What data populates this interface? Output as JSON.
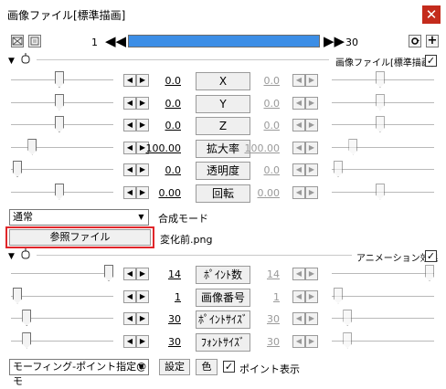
{
  "window": {
    "title": "画像ファイル[標準描画]",
    "close_glyph": "✕"
  },
  "frame": {
    "start": "1",
    "end": "30",
    "progress": 1.0
  },
  "section1": {
    "label": "画像ファイル[標準描画]",
    "checked": true
  },
  "params1": [
    {
      "label": "X",
      "value": "0.0",
      "value2": "0.0",
      "level": 0.47,
      "level2": 0.47
    },
    {
      "label": "Y",
      "value": "0.0",
      "value2": "0.0",
      "level": 0.47,
      "level2": 0.47
    },
    {
      "label": "Z",
      "value": "0.0",
      "value2": "0.0",
      "level": 0.47,
      "level2": 0.47
    },
    {
      "label": "拡大率",
      "value": "100.00",
      "value2": "100.00",
      "level": 0.18,
      "level2": 0.18
    },
    {
      "label": "透明度",
      "value": "0.0",
      "value2": "0.0",
      "level": 0.02,
      "level2": 0.02
    },
    {
      "label": "回転",
      "value": "0.00",
      "value2": "0.00",
      "level": 0.47,
      "level2": 0.47
    }
  ],
  "blend": {
    "selected": "通常",
    "label": "合成モード"
  },
  "ref_file": {
    "button": "参照ファイル",
    "filename": "変化前.png"
  },
  "section2": {
    "label": "アニメーション効果",
    "checked": true
  },
  "params2": [
    {
      "label": "ﾎﾟｲﾝﾄ数",
      "value": "14",
      "value2": "14",
      "level": 1.0,
      "level2": 1.0
    },
    {
      "label": "画像番号",
      "value": "1",
      "value2": "1",
      "level": 0.02,
      "level2": 0.02
    },
    {
      "label": "ﾎﾟｲﾝﾄｻｲｽﾞ",
      "value": "30",
      "value2": "30",
      "level": 0.12,
      "level2": 0.12
    },
    {
      "label": "ﾌｫﾝﾄｻｲｽﾞ",
      "value": "30",
      "value2": "30",
      "level": 0.12,
      "level2": 0.12
    }
  ],
  "bottom": {
    "effect_select": "モーフィング-ポイント指定@モ",
    "settings": "設定",
    "color": "色",
    "point_display_label": "ポイント表示",
    "point_display_checked": true
  },
  "colors": {
    "frame_bar": "#3c8ee6",
    "close": "#c42b1c",
    "highlight": "#e0262a"
  },
  "icons": {
    "left_icon1": "film-strip-icon",
    "left_icon2": "frame-box-icon",
    "prev_key": "double-left-arrow-icon",
    "next_key": "double-right-arrow-icon",
    "refresh": "refresh-icon",
    "add": "plus-icon",
    "collapse": "triangle-down-icon",
    "camera": "camera-icon"
  }
}
